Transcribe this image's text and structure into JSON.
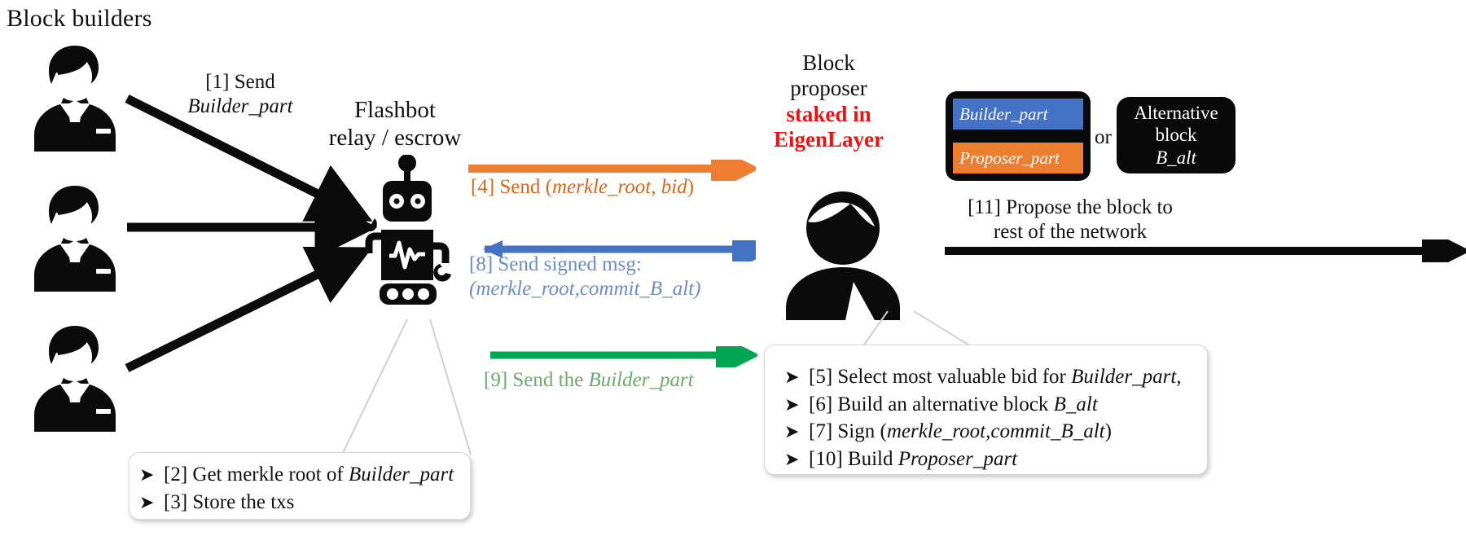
{
  "title": "Block builders",
  "flashbot": {
    "line1": "Flashbot",
    "line2": "relay / escrow"
  },
  "proposer": {
    "line1": "Block",
    "line2": "proposer",
    "line3": "staked in",
    "line4": "EigenLayer",
    "highlight_color": "#ee1111"
  },
  "builders": [
    {
      "name": "block-builder-1"
    },
    {
      "name": "block-builder-2"
    },
    {
      "name": "block-builder-3"
    }
  ],
  "arrows": {
    "step1": {
      "label_line1": "[1] Send",
      "label_line2": "Builder_part",
      "color": "#000000"
    },
    "step4": {
      "prefix": "[4] Send (",
      "italic": "merkle_root, bid",
      "suffix": ")",
      "color": "#ed7d31",
      "direction": "right"
    },
    "step8": {
      "line1": "[8] Send signed msg:",
      "line2": "(merkle_root,commit_B_alt)",
      "color": "#4472c4",
      "direction": "left"
    },
    "step9": {
      "prefix": "[9] Send the ",
      "italic": "Builder_part",
      "color": "#00a651",
      "direction": "right"
    },
    "step11": {
      "line1": "[11] Propose the block to",
      "line2": "rest of the network",
      "color": "#000000",
      "direction": "right"
    }
  },
  "block_visual": {
    "builder_part": "Builder_part",
    "proposer_part": "Proposer_part",
    "builder_color": "#4472c4",
    "proposer_color": "#ed7d31",
    "or": "or",
    "alt_line1": "Alternative",
    "alt_line2": "block",
    "alt_line3": "B_alt"
  },
  "callout_relay": {
    "items": [
      {
        "bullet": "➤",
        "prefix": "[2] Get merkle root of ",
        "italic": "Builder_part",
        "suffix": ""
      },
      {
        "bullet": "➤",
        "prefix": "[3] Store the txs",
        "italic": "",
        "suffix": ""
      }
    ]
  },
  "callout_proposer": {
    "items": [
      {
        "bullet": "➤",
        "prefix": "[5] Select most valuable bid for ",
        "italic": "Builder_part,",
        "suffix": ""
      },
      {
        "bullet": "➤",
        "prefix": "[6] Build an alternative block ",
        "italic": "B_alt",
        "suffix": ""
      },
      {
        "bullet": "➤",
        "prefix": "[7] Sign (",
        "italic": "merkle_root,commit_B_alt",
        "suffix": ")"
      },
      {
        "bullet": "➤",
        "prefix": "[10] Build ",
        "italic": "Proposer_part",
        "suffix": ""
      }
    ]
  }
}
